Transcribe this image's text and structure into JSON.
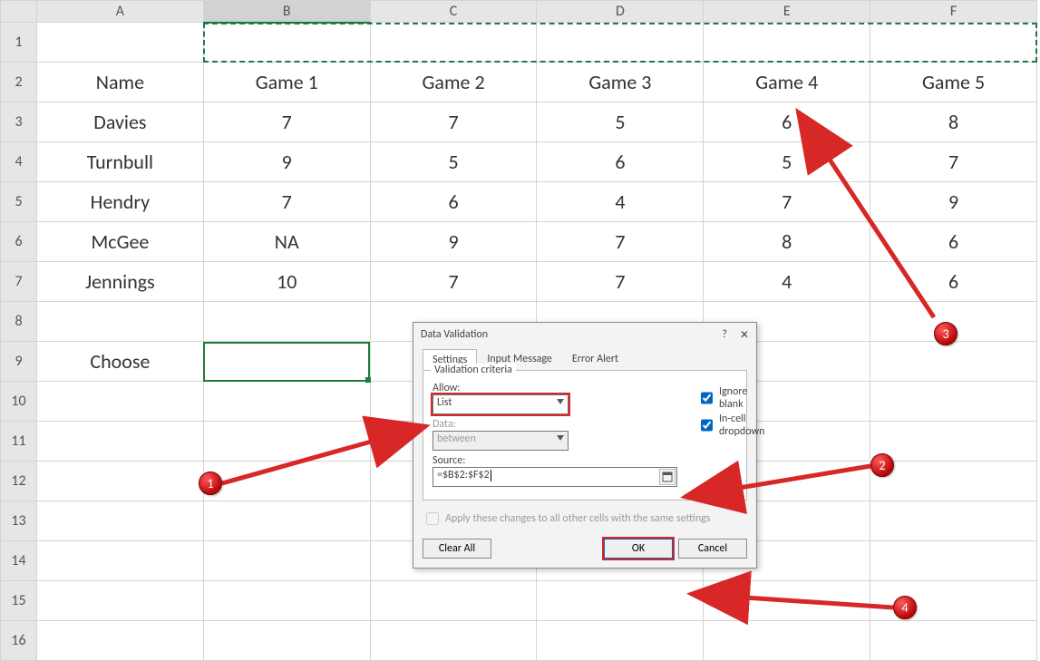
{
  "columns": [
    "A",
    "B",
    "C",
    "D",
    "E",
    "F"
  ],
  "rows": [
    "1",
    "2",
    "3",
    "4",
    "5",
    "6",
    "7",
    "8",
    "9",
    "10",
    "11",
    "12",
    "13",
    "14",
    "15",
    "16"
  ],
  "data": {
    "r1": [
      "",
      "",
      "",
      "",
      "",
      ""
    ],
    "r2": [
      "Name",
      "Game 1",
      "Game 2",
      "Game 3",
      "Game 4",
      "Game 5"
    ],
    "r3": [
      "Davies",
      "7",
      "7",
      "5",
      "6",
      "8"
    ],
    "r4": [
      "Turnbull",
      "9",
      "5",
      "6",
      "5",
      "7"
    ],
    "r5": [
      "Hendry",
      "7",
      "6",
      "4",
      "7",
      "9"
    ],
    "r6": [
      "McGee",
      "NA",
      "9",
      "7",
      "8",
      "6"
    ],
    "r7": [
      "Jennings",
      "10",
      "7",
      "7",
      "4",
      "6"
    ],
    "r8": [
      "",
      "",
      "",
      "",
      "",
      ""
    ],
    "r9": [
      "Choose",
      "",
      "",
      "",
      "",
      ""
    ],
    "r10": [
      "",
      "",
      "",
      "",
      "",
      ""
    ]
  },
  "dialog": {
    "title": "Data Validation",
    "help": "?",
    "close": "✕",
    "tabs": [
      "Settings",
      "Input Message",
      "Error Alert"
    ],
    "group": "Validation criteria",
    "allow_label": "Allow:",
    "allow_value": "List",
    "ignore_blank": "Ignore blank",
    "incell": "In-cell dropdown",
    "data_label": "Data:",
    "data_value": "between",
    "source_label": "Source:",
    "source_value": "=$B$2:$F$2",
    "apply": "Apply these changes to all other cells with the same settings",
    "clear": "Clear All",
    "ok": "OK",
    "cancel": "Cancel"
  },
  "badges": {
    "b1": "1",
    "b2": "2",
    "b3": "3",
    "b4": "4"
  }
}
